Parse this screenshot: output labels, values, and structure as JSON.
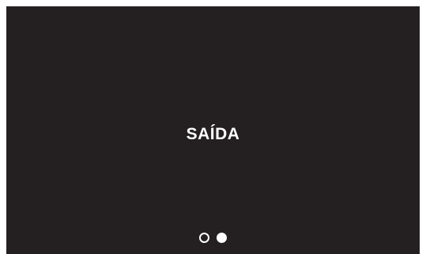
{
  "slide": {
    "title": "SAÍDA"
  },
  "pager": {
    "total": 2,
    "current": 2
  },
  "colors": {
    "background": "#242021",
    "text": "#ffffff",
    "page": "#ffffff"
  }
}
